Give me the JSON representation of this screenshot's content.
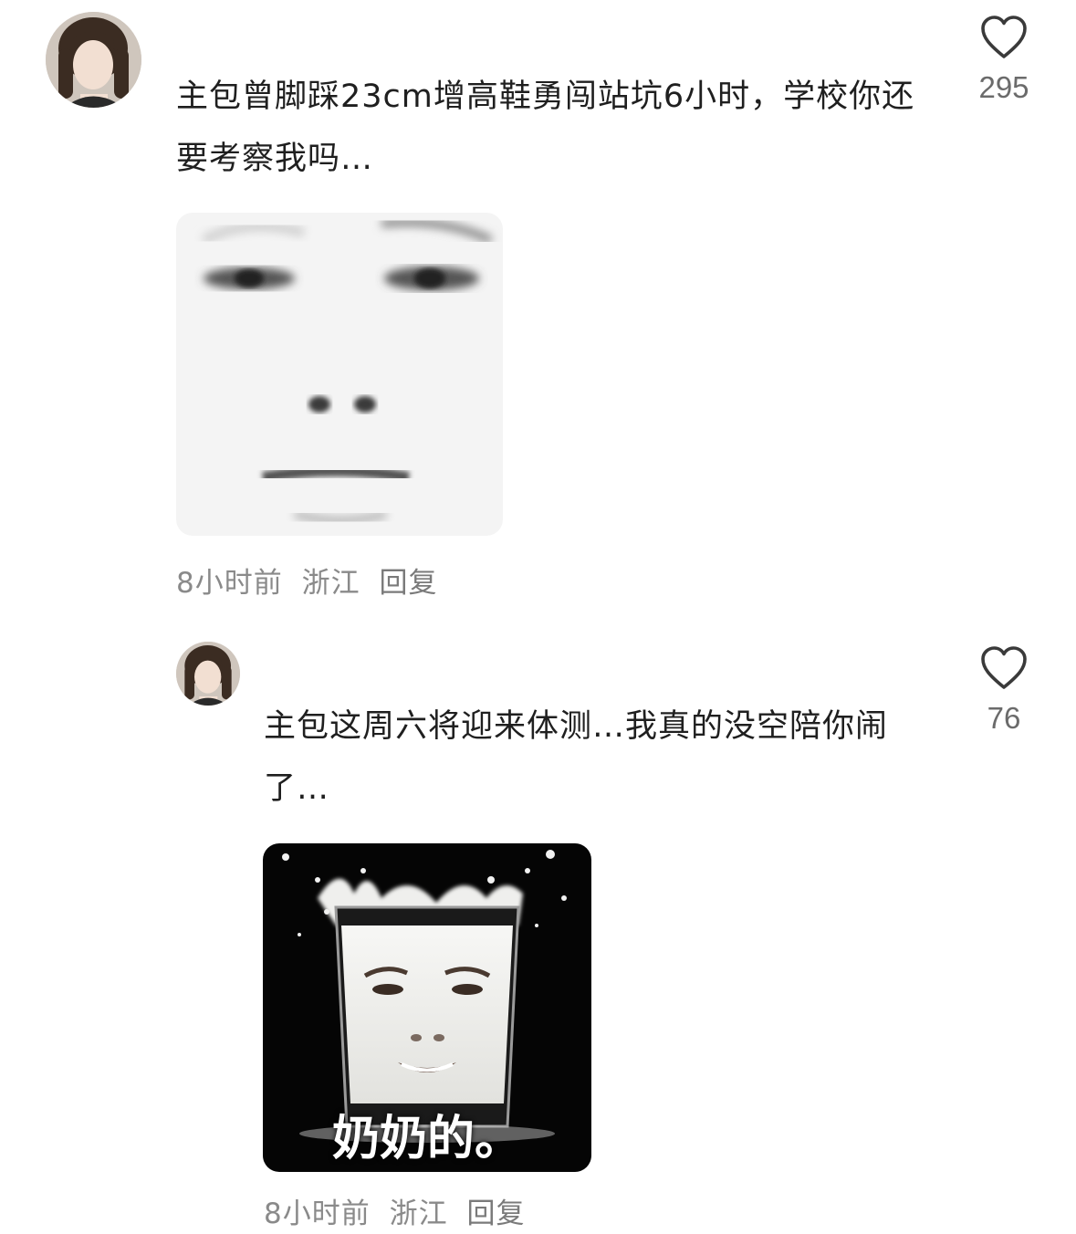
{
  "comments": [
    {
      "text": "主包曾脚踩23cm增高鞋勇闯站坑6小时，学校你还要考察我吗…",
      "likes": "295",
      "time": "8小时前",
      "location": "浙江",
      "reply_label": "回复",
      "sticker_caption": ""
    },
    {
      "text": "主包这周六将迎来体测…我真的没空陪你闹了…",
      "likes": "76",
      "time": "8小时前",
      "location": "浙江",
      "reply_label": "回复",
      "sticker_caption": "奶奶的。"
    }
  ],
  "icons": {
    "like": "heart-outline-icon",
    "avatar": "user-avatar"
  },
  "colors": {
    "text": "#1f1f1f",
    "meta": "#8a8a8a",
    "like_count": "#6b6b6b",
    "icon_stroke": "#3a3a3a"
  }
}
